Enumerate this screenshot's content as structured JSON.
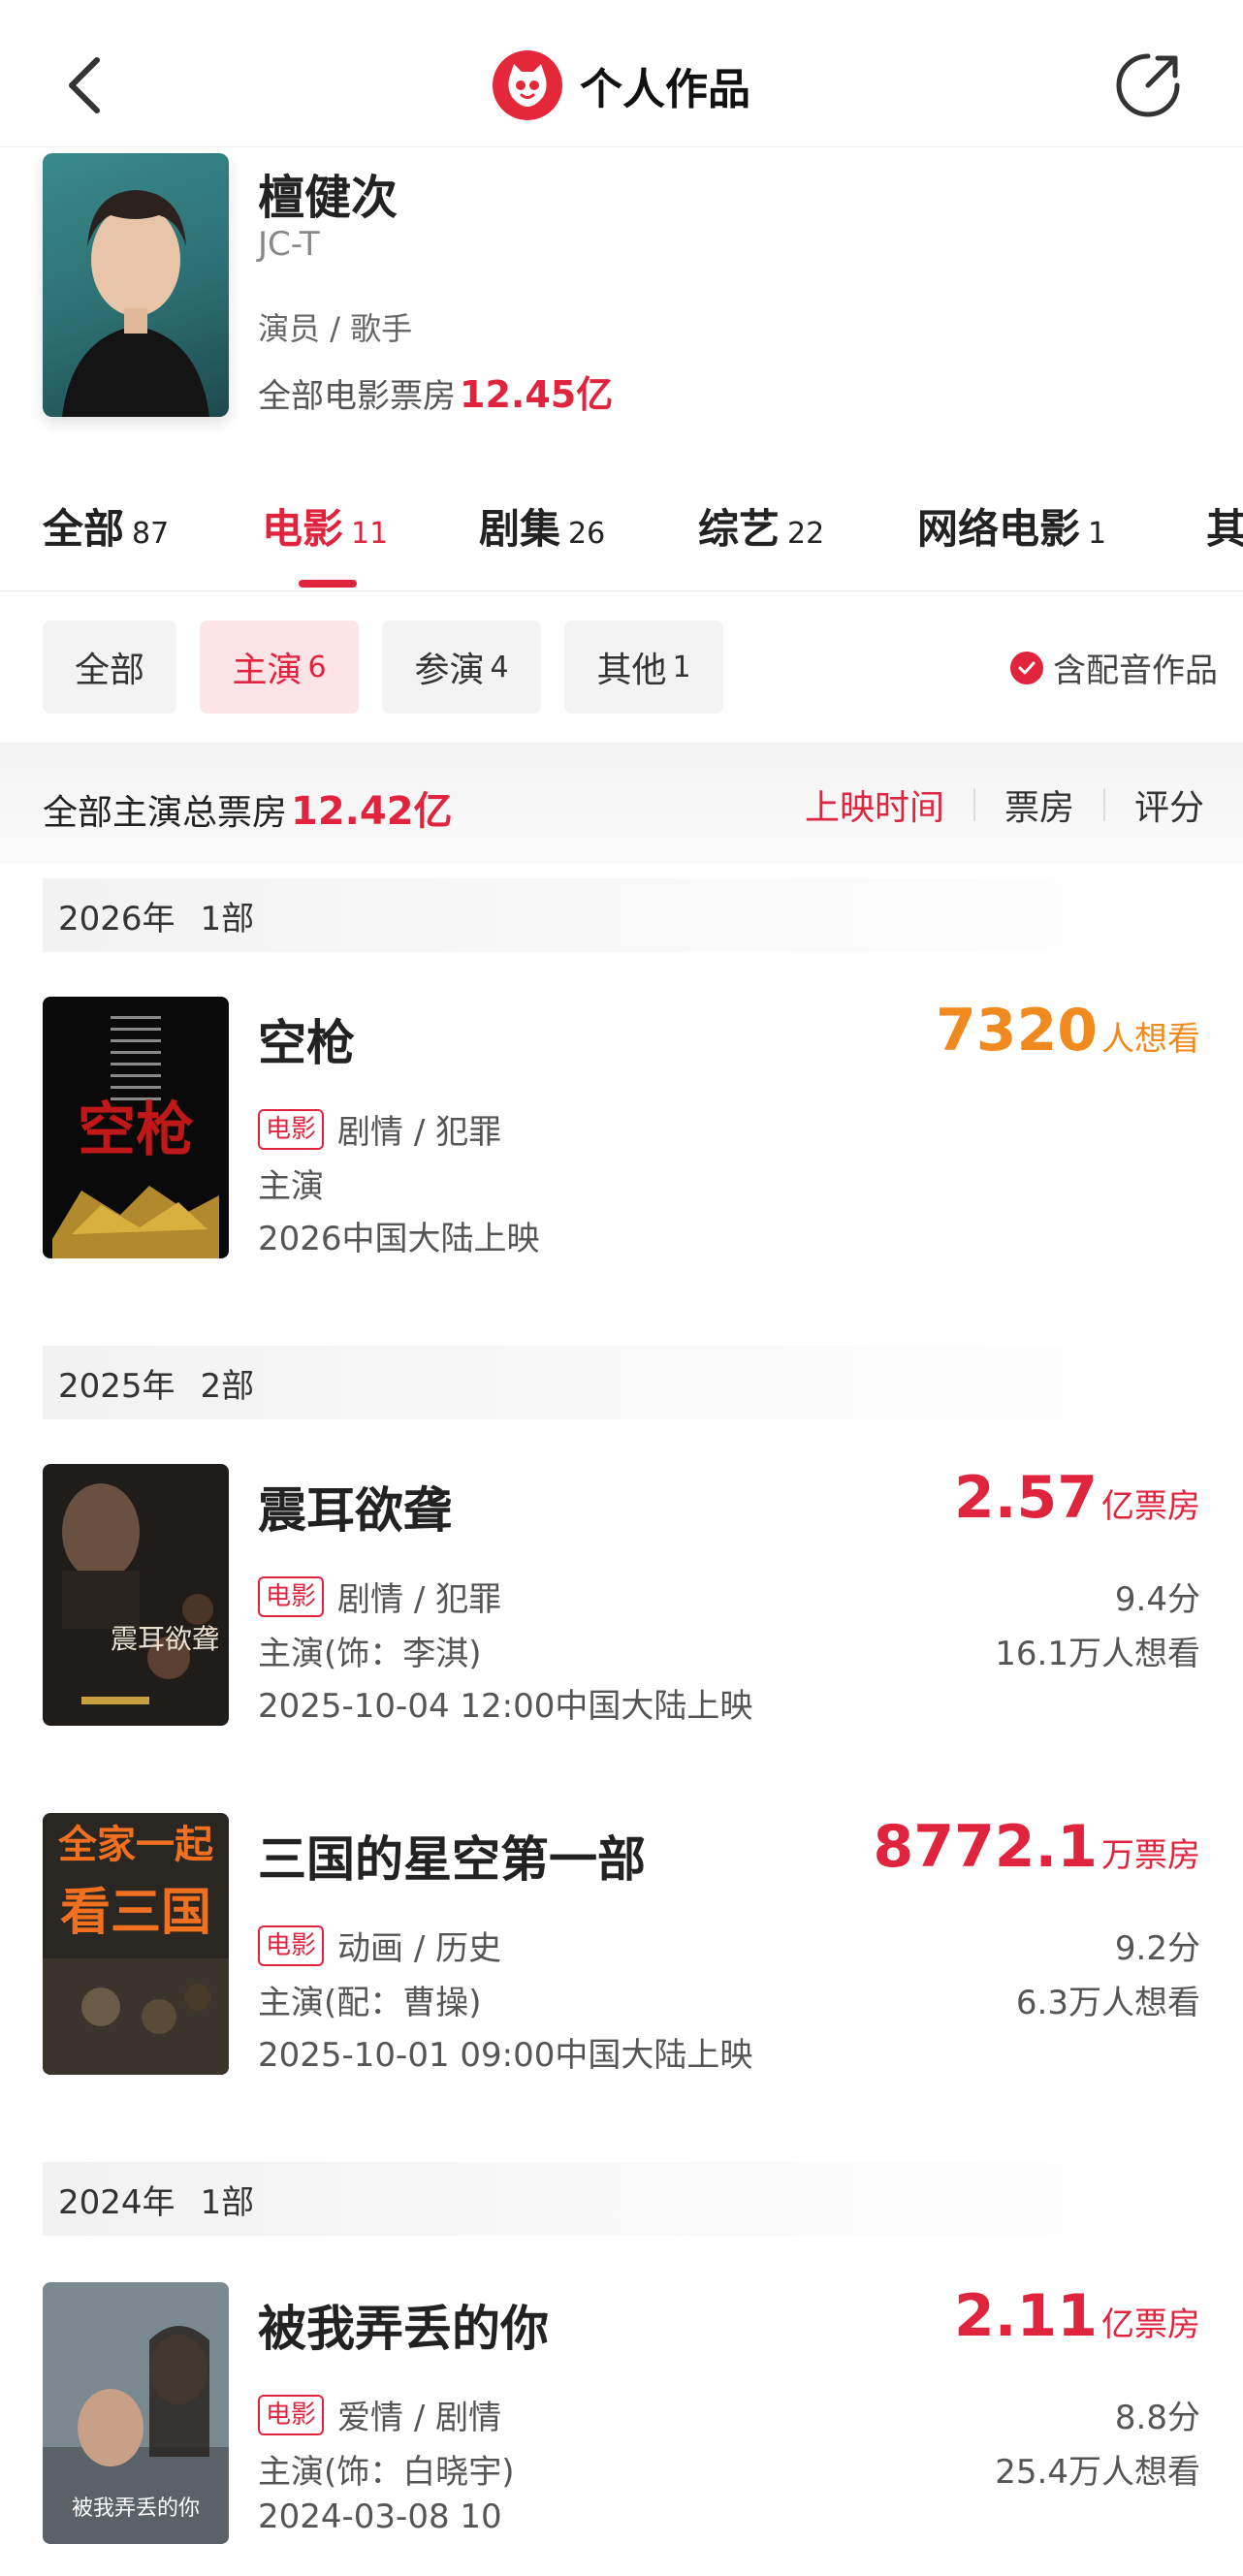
{
  "header": {
    "title": "个人作品"
  },
  "profile": {
    "name": "檀健次",
    "en_name": "JC-T",
    "roles": "演员 / 歌手",
    "box_label": "全部电影票房",
    "box_value": "12.45亿"
  },
  "tabs": [
    {
      "label": "全部",
      "count": "87"
    },
    {
      "label": "电影",
      "count": "11"
    },
    {
      "label": "剧集",
      "count": "26"
    },
    {
      "label": "综艺",
      "count": "22"
    },
    {
      "label": "网络电影",
      "count": "1"
    },
    {
      "label": "其"
    }
  ],
  "filters": [
    {
      "label": "全部"
    },
    {
      "label": "主演",
      "count": "6"
    },
    {
      "label": "参演",
      "count": "4"
    },
    {
      "label": "其他",
      "count": "1"
    }
  ],
  "dub_toggle": "含配音作品",
  "summary": {
    "label": "全部主演总票房",
    "value": "12.42亿",
    "sorts": [
      "上映时间",
      "票房",
      "评分"
    ]
  },
  "years": [
    {
      "year": "2026年",
      "count": "1部"
    },
    {
      "year": "2025年",
      "count": "2部"
    },
    {
      "year": "2024年",
      "count": "1部"
    }
  ],
  "movies": [
    {
      "title": "空枪",
      "tag": "电影",
      "genre": "剧情 / 犯罪",
      "role": "主演",
      "date": "2026中国大陆上映",
      "stat_value": "7320",
      "stat_unit": "人想看"
    },
    {
      "title": "震耳欲聋",
      "tag": "电影",
      "genre": "剧情 / 犯罪",
      "role": "主演(饰：李淇)",
      "date": "2025-10-04 12:00中国大陆上映",
      "stat_value": "2.57",
      "stat_unit": "亿票房",
      "score": "9.4分",
      "want": "16.1万人想看"
    },
    {
      "title": "三国的星空第一部",
      "tag": "电影",
      "genre": "动画 / 历史",
      "role": "主演(配：曹操)",
      "date": "2025-10-01 09:00中国大陆上映",
      "stat_value": "8772.1",
      "stat_unit": "万票房",
      "score": "9.2分",
      "want": "6.3万人想看"
    },
    {
      "title": "被我弄丢的你",
      "tag": "电影",
      "genre": "爱情 / 剧情",
      "role": "主演(饰：白晓宇)",
      "date": "2024-03-08 10",
      "stat_value": "2.11",
      "stat_unit": "亿票房",
      "score": "8.8分",
      "want": "25.4万人想看"
    }
  ],
  "poster_text": {
    "m0": "空枪",
    "m1": "震耳欲聋",
    "m2a": "全家一起",
    "m2b": "看三国",
    "m3": "被我弄丢的你"
  },
  "colors": {
    "accent": "#e0243e",
    "orange": "#f08a1e"
  }
}
